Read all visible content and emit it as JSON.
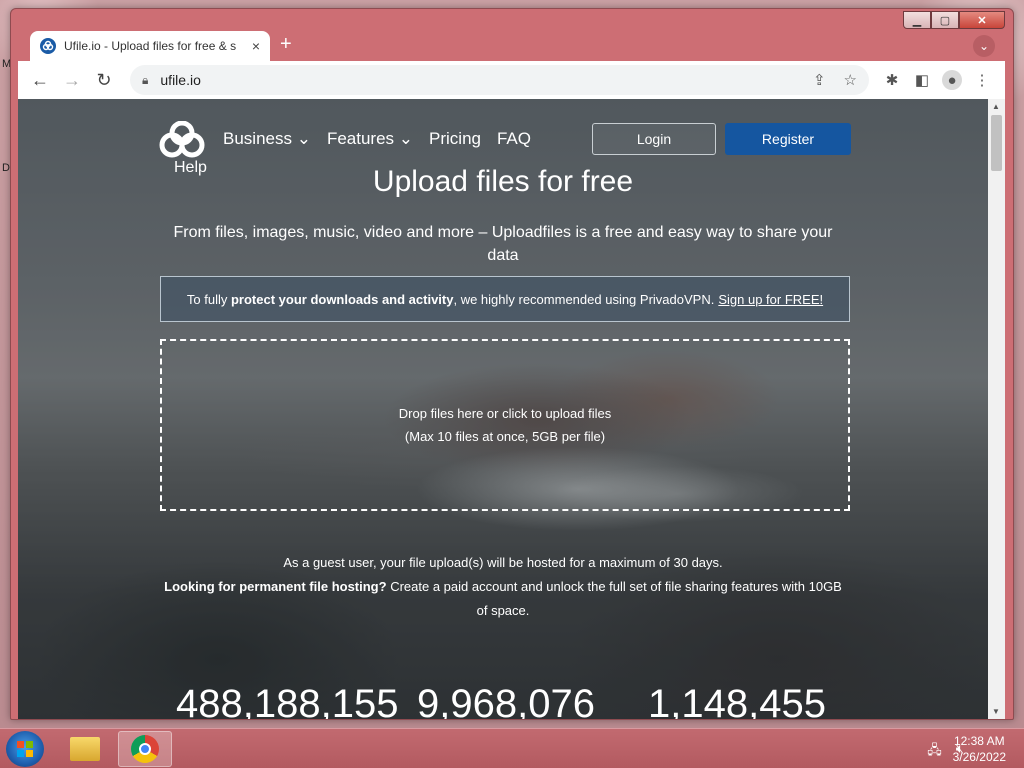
{
  "desktop": {
    "letters": [
      "M",
      "D"
    ]
  },
  "browser": {
    "tab_title": "Ufile.io - Upload files for free & s",
    "tab_close": "×",
    "new_tab": "+",
    "url": "ufile.io"
  },
  "site": {
    "help": "Help",
    "nav": [
      {
        "label": "Business ⌄"
      },
      {
        "label": "Features ⌄"
      },
      {
        "label": "Pricing"
      },
      {
        "label": "FAQ"
      }
    ],
    "login": "Login",
    "register": "Register",
    "title": "Upload files for free",
    "subtitle": "From files, images, music, video and more – Uploadfiles is a free and easy way to share your data",
    "vpn": {
      "prefix": "To fully",
      "bold": "protect your downloads and activity",
      "middle": ", we highly recommended using PrivadoVPN.",
      "link": "Sign up for FREE!"
    },
    "drop": {
      "line1": "Drop files here or click to upload files",
      "line2": "(Max 10 files at once, 5GB per file)"
    },
    "guest_line": "As a guest user, your file upload(s) will be hosted for a maximum of 30 days.",
    "perm_bold": "Looking for permanent file hosting?",
    "perm_text": "Create a paid account and unlock the full set of file sharing features with 10GB of space.",
    "stats": [
      "488,188,155",
      "9,968,076",
      "1,148,455"
    ]
  },
  "taskbar": {
    "time": "12:38 AM",
    "date": "3/26/2022"
  }
}
